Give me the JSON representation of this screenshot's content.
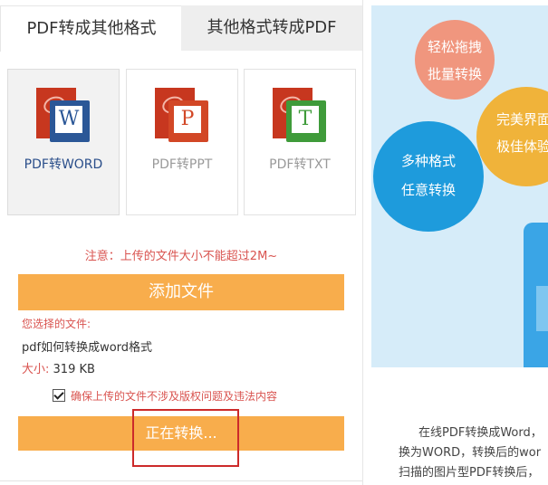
{
  "tabs": [
    {
      "label": "PDF转成其他格式",
      "active": true
    },
    {
      "label": "其他格式转成PDF",
      "active": false
    }
  ],
  "formats": [
    {
      "label": "PDF转WORD",
      "letter": "W",
      "color": "#2b5797",
      "selected": true
    },
    {
      "label": "PDF转PPT",
      "letter": "P",
      "color": "#d24726",
      "selected": false
    },
    {
      "label": "PDF转TXT",
      "letter": "T",
      "color": "#3f9b3a",
      "selected": false
    }
  ],
  "upload": {
    "notice": "注意：上传的文件大小不能超过2M~",
    "add_button": "添加文件",
    "selected_label": "您选择的文件:",
    "selected_file": "pdf如何转换成word格式",
    "size_label": "大小:",
    "size_value": "319 KB",
    "agree_text": "确保上传的文件不涉及版权问题及违法内容",
    "agree_checked": true,
    "convert_button": "正在转换..."
  },
  "banner": {
    "bubbles": [
      {
        "line1": "轻松拖拽",
        "line2": "批量转换",
        "color": "#f0967e"
      },
      {
        "line1": "完美界面",
        "line2": "极佳体验",
        "color": "#f0b33a"
      },
      {
        "line1": "多种格式",
        "line2": "任意转换",
        "color": "#1e9bdc"
      }
    ]
  },
  "description": {
    "lines": [
      "在线PDF转换成Word，",
      "换为WORD，转换后的wor",
      "扫描的图片型PDF转换后，"
    ]
  },
  "colors": {
    "accent_orange": "#f8ad4c",
    "warning_red": "#d9534f",
    "highlight_red": "#cc2a2a"
  }
}
